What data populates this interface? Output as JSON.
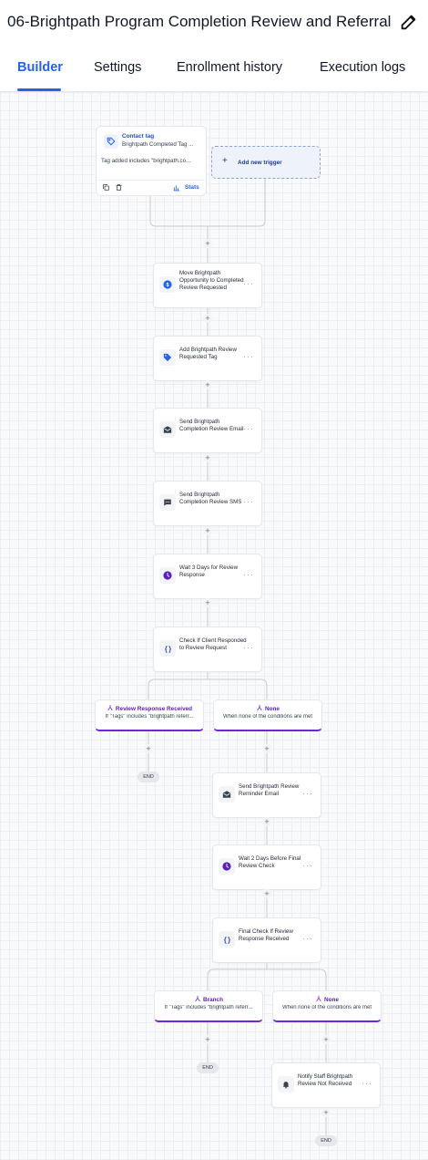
{
  "header": {
    "title": "06-Brightpath Program Completion Review and Referral",
    "edit_icon": "pencil-icon"
  },
  "tabs": [
    {
      "label": "Builder",
      "active": true
    },
    {
      "label": "Settings"
    },
    {
      "label": "Enrollment history"
    },
    {
      "label": "Execution logs"
    }
  ],
  "trigger": {
    "title": "Contact tag",
    "subtitle": "Brightpath Completed Tag ...",
    "detail": "Tag added includes \"brightpath.co...",
    "stats_label": "Stats"
  },
  "add_trigger": {
    "label": "Add new trigger"
  },
  "steps": [
    {
      "label": "Move Brightpath Opportunity to Completed Review Requested",
      "icon": "dollar-icon"
    },
    {
      "label": "Add Brightpath Review Requested Tag",
      "icon": "tag-icon"
    },
    {
      "label": "Send Brightpath Completion Review Email",
      "icon": "email-icon"
    },
    {
      "label": "Send Brightpath Completion Review SMS",
      "icon": "sms-icon"
    },
    {
      "label": "Wait 3 Days for Review Response",
      "icon": "clock-icon"
    },
    {
      "label": "Check If Client Responded to Review Request",
      "icon": "condition-icon"
    },
    {
      "label": "Send Brightpath Review Reminder Email",
      "icon": "email-icon"
    },
    {
      "label": "Wait 2 Days Before Final Review Check",
      "icon": "clock-icon"
    },
    {
      "label": "Final Check If Review Response Received",
      "icon": "condition-icon"
    },
    {
      "label": "Notify Staff Brightpath Review Not Received",
      "icon": "bell-icon"
    }
  ],
  "conditions": [
    {
      "title": "Review Response Received",
      "subtitle": "If \"Tags\" includes \"brightpath referr..."
    },
    {
      "title": "None",
      "subtitle": "When none of the conditions are met"
    },
    {
      "title": "Branch",
      "subtitle": "If \"Tags\" includes \"brightpath referr..."
    },
    {
      "title": "None",
      "subtitle": "When none of the conditions are met"
    }
  ],
  "end_label": "END",
  "colors": {
    "accent": "#2563eb",
    "branch": "#6d28d9"
  }
}
